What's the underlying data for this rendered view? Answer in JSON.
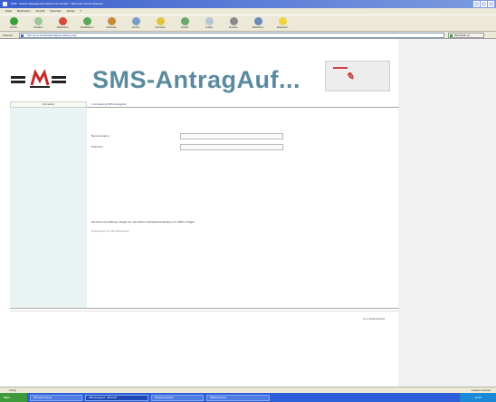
{
  "window": {
    "title": "SMS - Sachen Management System für Fordern - Microsoft Internet Explorer"
  },
  "menu": [
    "Datei",
    "Bearbeiten",
    "Ansicht",
    "Favoriten",
    "Extras",
    "?"
  ],
  "toolbar": [
    "Zurück",
    "Vorwärts",
    "Abbrechen",
    "Aktualisieren",
    "Startseite",
    "Suchen",
    "Favoriten",
    "Verlauf",
    "E-Mail",
    "Drucken",
    "Bearbeiten",
    "Diskussion"
  ],
  "address": {
    "label": "Adresse",
    "url": "http://sms.intranet/antrag/anmeldung.asp",
    "go_label": "Wechseln zu"
  },
  "page": {
    "logo_text": "SMS",
    "headline": "SMS-AntragAuf...",
    "nav_button": "Anmelden",
    "breadcrumb": "> Anmeldung SMS-AntragAuf",
    "username_label": "Benutzername :",
    "password_label": "Passwort :",
    "username_value": "",
    "password_value": "",
    "info_text": "Die letzte Anmeldung erfolgte von der letzten Netzwerkanmeldung vom 2004 in Tagen",
    "info_link": "Änderungen am Benutzerkonto",
    "footer_link": "zum Seitenanfang"
  },
  "status": {
    "text": "Fertig",
    "zone": "Lokales Intranet"
  },
  "taskbar": {
    "start": "Start",
    "tasks": [
      "Microsoft Outlook",
      "SMS-AntragAuf - Microsoft",
      "Windows Explorer",
      "Bildbearbeitung"
    ],
    "clock": "14:35"
  },
  "colors": {
    "headline": "#5a8a9e",
    "sidebar": "#eaf3f3",
    "titlebar": "#3a5fcd"
  }
}
